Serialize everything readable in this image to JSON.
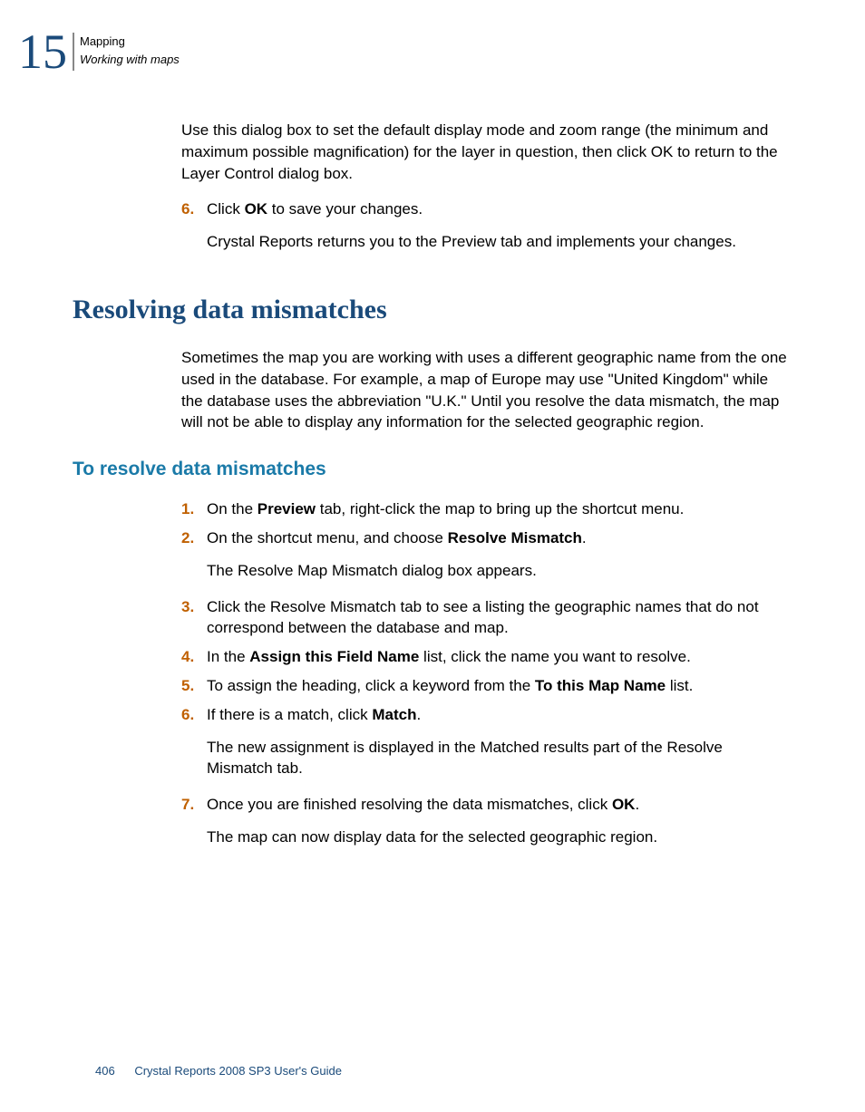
{
  "header": {
    "chapter_number": "15",
    "line1": "Mapping",
    "line2": "Working with maps"
  },
  "intro_paragraph": "Use this dialog box to set the default display mode and zoom range (the minimum and maximum possible magnification) for the layer in question, then click OK to return to the Layer Control dialog box.",
  "step6": {
    "marker": "6.",
    "pre": "Click ",
    "bold": "OK",
    "post": " to save your changes.",
    "follow": "Crystal Reports returns you to the Preview tab and implements your changes."
  },
  "section_heading": "Resolving data mismatches",
  "section_body": "Sometimes the map you are working with uses a different geographic name from the one used in the database. For example, a map of Europe may use \"United Kingdom\" while the database uses the abbreviation \"U.K.\" Until you resolve the data mismatch, the map will not be able to display any information for the selected geographic region.",
  "subsection_heading": "To resolve data mismatches",
  "steps": {
    "s1": {
      "marker": "1.",
      "pre": "On the ",
      "bold": "Preview",
      "post": " tab, right-click the map to bring up the shortcut menu."
    },
    "s2": {
      "marker": "2.",
      "pre": "On the shortcut menu, and choose ",
      "bold": "Resolve Mismatch",
      "post": ".",
      "follow": "The Resolve Map Mismatch dialog box appears."
    },
    "s3": {
      "marker": "3.",
      "text": "Click the Resolve Mismatch tab to see a listing the geographic names that do not correspond between the database and map."
    },
    "s4": {
      "marker": "4.",
      "pre": "In the ",
      "bold": "Assign this Field Name",
      "post": " list, click the name you want to resolve."
    },
    "s5": {
      "marker": "5.",
      "pre": "To assign the heading, click a keyword from the ",
      "bold": "To this Map Name",
      "post": " list."
    },
    "s6": {
      "marker": "6.",
      "pre": "If there is a match, click ",
      "bold": "Match",
      "post": ".",
      "follow": "The new assignment is displayed in the Matched results part of the Resolve Mismatch tab."
    },
    "s7": {
      "marker": "7.",
      "pre": "Once you are finished resolving the data mismatches, click ",
      "bold": "OK",
      "post": ".",
      "follow": "The map can now display data for the selected geographic region."
    }
  },
  "footer": {
    "page": "406",
    "title": "Crystal Reports 2008 SP3 User's Guide"
  }
}
